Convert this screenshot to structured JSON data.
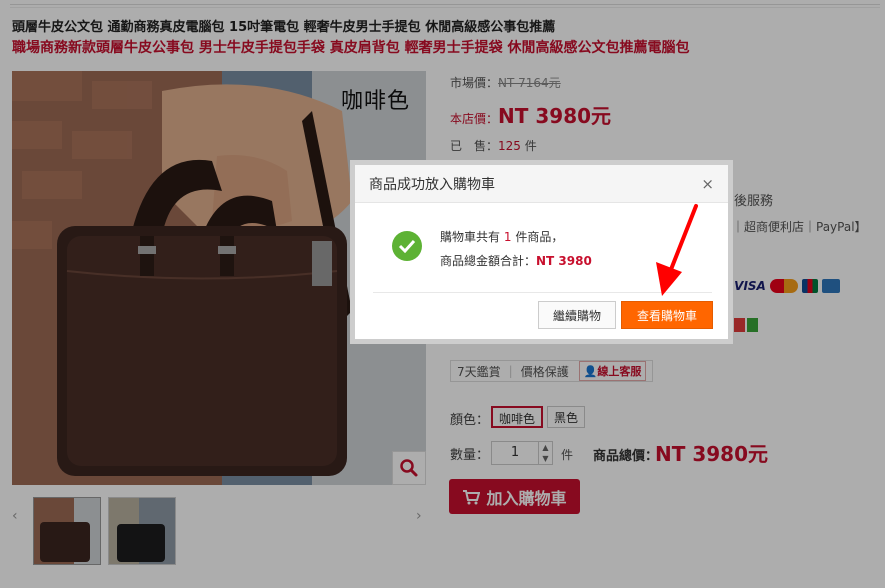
{
  "header": {
    "subtitle": "頭層牛皮公文包 通勤商務真皮電腦包 15吋筆電包 輕奢牛皮男士手提包 休閒高級感公事包推薦",
    "title": "職場商務新款頭層牛皮公事包 男士牛皮手提包手袋 真皮肩背包 輕奢男士手提袋 休閒高級感公文包推薦電腦包"
  },
  "gallery": {
    "color_caption": "咖啡色",
    "prev_arrow": "‹",
    "next_arrow": "›"
  },
  "pricing": {
    "market_label": "市場價：",
    "market_price": "NT 7164元",
    "store_label": "本店價：",
    "store_price": "NT 3980元",
    "sold_label": "已　售：",
    "sold_count": "125",
    "sold_unit": "件"
  },
  "partial_text": {
    "service": "後服務",
    "payments": "】｜超商便利店｜PayPal】"
  },
  "guarantee": {
    "item1": "7天鑑賞",
    "item2": "價格保護",
    "customer_service": "線上客服"
  },
  "options": {
    "color_label": "顏色：",
    "colors": [
      "咖啡色",
      "黑色"
    ],
    "qty_label": "數量：",
    "qty_value": "1",
    "qty_unit": "件",
    "total_label": "商品總價：",
    "total_value": "NT 3980元",
    "add_to_cart": "加入購物車"
  },
  "dialog": {
    "title": "商品成功放入購物車",
    "close": "×",
    "msg_prefix": "購物車共有",
    "msg_count": "1",
    "msg_suffix": "件商品，",
    "total_label": "商品總金額合計：",
    "total_value": "NT 3980",
    "continue_label": "繼續購物",
    "view_cart_label": "查看購物車"
  },
  "colors": {
    "accent_red": "#c8102e",
    "orange": "#ff6600",
    "success_green": "#5db234"
  }
}
